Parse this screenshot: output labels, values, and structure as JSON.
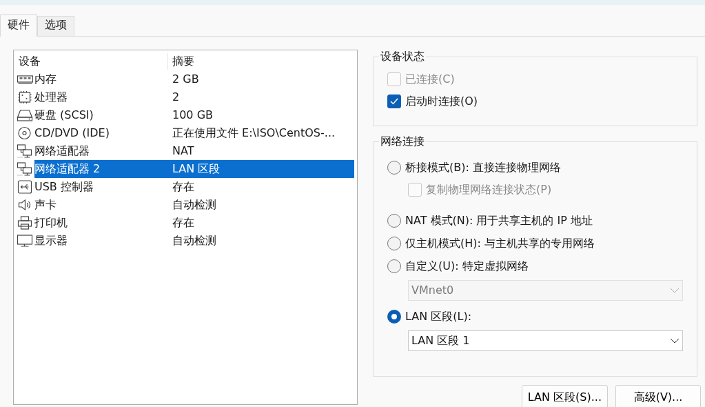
{
  "tabs": [
    {
      "label": "硬件",
      "selected": true
    },
    {
      "label": "选项",
      "selected": false
    }
  ],
  "device_table": {
    "columns": [
      "设备",
      "摘要"
    ],
    "rows": [
      {
        "kind": "memory",
        "device": "内存",
        "summary": "2 GB",
        "selected": false
      },
      {
        "kind": "cpu",
        "device": "处理器",
        "summary": "2",
        "selected": false
      },
      {
        "kind": "disk",
        "device": "硬盘 (SCSI)",
        "summary": "100 GB",
        "selected": false
      },
      {
        "kind": "cd",
        "device": "CD/DVD (IDE)",
        "summary": "正在使用文件 E:\\ISO\\CentOS-...",
        "selected": false
      },
      {
        "kind": "network",
        "device": "网络适配器",
        "summary": "NAT",
        "selected": false
      },
      {
        "kind": "network",
        "device": "网络适配器 2",
        "summary": "LAN 区段",
        "selected": true
      },
      {
        "kind": "usb",
        "device": "USB 控制器",
        "summary": "存在",
        "selected": false
      },
      {
        "kind": "sound",
        "device": "声卡",
        "summary": "自动检测",
        "selected": false
      },
      {
        "kind": "printer",
        "device": "打印机",
        "summary": "存在",
        "selected": false
      },
      {
        "kind": "display",
        "device": "显示器",
        "summary": "自动检测",
        "selected": false
      }
    ]
  },
  "device_status": {
    "title": "设备状态",
    "options": [
      {
        "label": "已连接(C)",
        "checked": false,
        "disabled": true
      },
      {
        "label": "启动时连接(O)",
        "checked": true,
        "disabled": false
      }
    ]
  },
  "network_connection": {
    "title": "网络连接",
    "items": [
      {
        "kind": "radio",
        "label": "桥接模式(B): 直接连接物理网络",
        "selected": false
      },
      {
        "kind": "checkbox",
        "label": "复制物理网络连接状态(P)",
        "checked": false,
        "disabled": true
      },
      {
        "kind": "radio",
        "label": "NAT 模式(N): 用于共享主机的 IP 地址",
        "selected": false
      },
      {
        "kind": "radio",
        "label": "仅主机模式(H): 与主机共享的专用网络",
        "selected": false
      },
      {
        "kind": "radio",
        "label": "自定义(U): 特定虚拟网络",
        "selected": false
      },
      {
        "kind": "select",
        "value": "VMnet0",
        "disabled": true
      },
      {
        "kind": "radio",
        "label": "LAN 区段(L):",
        "selected": true
      },
      {
        "kind": "select",
        "value": "LAN 区段 1",
        "disabled": false
      }
    ]
  },
  "buttons": [
    "LAN 区段(S)...",
    "高级(V)..."
  ]
}
